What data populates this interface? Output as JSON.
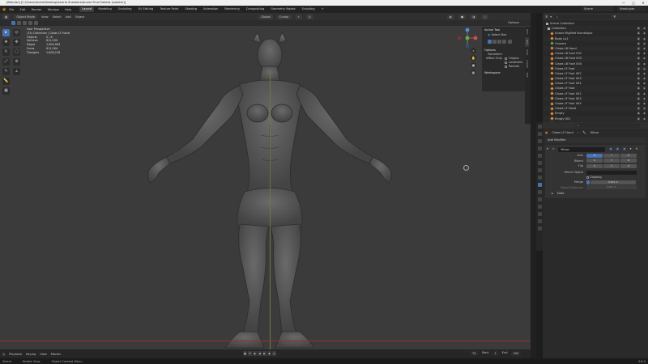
{
  "window": {
    "title": "[Blender] [C:\\Users\\Andre\\Desktop\\Anaria Sneakers\\Anaria Final Details (Lobster)]",
    "controls": [
      "—",
      "▢",
      "✕"
    ]
  },
  "topbar": {
    "menus": [
      "File",
      "Edit",
      "Render",
      "Window",
      "Help"
    ],
    "workspaces": [
      "Layout",
      "Modeling",
      "Sculpting",
      "UV Editing",
      "Texture Paint",
      "Shading",
      "Animation",
      "Rendering",
      "Compositing",
      "Geometry Nodes",
      "Scripting"
    ],
    "active_workspace": "Layout",
    "add": "+",
    "scene": "Scene",
    "view_layer": "ViewLayer"
  },
  "viewport_header": {
    "mode": "Object Mode",
    "menus": [
      "View",
      "Select",
      "Add",
      "Object"
    ],
    "transform": "Global",
    "pivot": "Cursor",
    "options": "Options"
  },
  "stats": {
    "view": "User Perspective",
    "context": "(74) Collection | Claws LF Hand",
    "rows": [
      {
        "k": "Objects",
        "v": "0 / 8"
      },
      {
        "k": "Vertices",
        "v": "812,290"
      },
      {
        "k": "Edges",
        "v": "1,604,584"
      },
      {
        "k": "Faces",
        "v": "811,264"
      },
      {
        "k": "Triangles",
        "v": "1,608,228"
      }
    ]
  },
  "tool_panel": {
    "active_tool": "Active Tool",
    "tool_name": "Select Box",
    "options": "Options",
    "transform": "Transform",
    "affect_only": "Affect Only",
    "checks": [
      "Origins",
      "Locations",
      "Parents"
    ],
    "workspace": "Workspace"
  },
  "npanel_tabs": [
    "Item",
    "Tool",
    "View",
    "Create",
    "Edit"
  ],
  "timeline": {
    "menus": [
      "Playback",
      "Keying",
      "View",
      "Marker"
    ],
    "current_frame": "74",
    "start_label": "Start",
    "start": "1",
    "end_label": "End",
    "end": "250"
  },
  "statusbar": {
    "items": [
      "Select",
      "Rotate View",
      "Object Context Menu"
    ],
    "version": "3.6.0"
  },
  "outliner": {
    "search_placeholder": "",
    "items": [
      {
        "name": "Scene Collection",
        "type": "coll"
      },
      {
        "name": "Collection",
        "type": "coll"
      },
      {
        "name": "Anaria Rigified Bumblejax",
        "type": "obj"
      },
      {
        "name": "Body Lo1",
        "type": "obj"
      },
      {
        "name": "Camera",
        "type": "green"
      },
      {
        "name": "Claws LB Hand",
        "type": "obj"
      },
      {
        "name": "Claws LB Foot 002",
        "type": "obj"
      },
      {
        "name": "Claws LB Foot 003",
        "type": "obj"
      },
      {
        "name": "Claws LB Foot 004",
        "type": "obj"
      },
      {
        "name": "Claws LF Foot",
        "type": "obj"
      },
      {
        "name": "Claws LF Foot 002",
        "type": "obj"
      },
      {
        "name": "Claws LF Foot 003",
        "type": "obj"
      },
      {
        "name": "Claws LF Foot 004",
        "type": "obj"
      },
      {
        "name": "Claws LF Foot",
        "type": "obj"
      },
      {
        "name": "Claws LF Foot 002",
        "type": "obj"
      },
      {
        "name": "Claws LF Foot 003",
        "type": "obj"
      },
      {
        "name": "Claws LF Foot 004",
        "type": "obj"
      },
      {
        "name": "Claws LF Hand",
        "type": "obj"
      },
      {
        "name": "Empty",
        "type": "obj"
      },
      {
        "name": "Empty 001",
        "type": "obj"
      },
      {
        "name": "Empty 002",
        "type": "obj"
      }
    ]
  },
  "properties": {
    "object_name": "Claws LF Hand",
    "modifier_tab": "Mirror",
    "add_modifier": "Add Modifier",
    "modifier_name": "Mirror",
    "axis_label": "Axis",
    "bisect_label": "Bisect",
    "flip_label": "Flip",
    "axes": [
      "X",
      "Y",
      "Z"
    ],
    "mirror_object_label": "Mirror Object",
    "clipping_label": "Clipping",
    "merge_label": "Merge",
    "merge_value": "0.001 m",
    "bisect_distance_label": "Bisect Distance",
    "bisect_distance_value": "0.001 m",
    "data_label": "Data"
  },
  "colors": {
    "accent": "#4772b3",
    "viewport_bg": "#3b3b3b",
    "panel_bg": "#2a2a2a"
  }
}
